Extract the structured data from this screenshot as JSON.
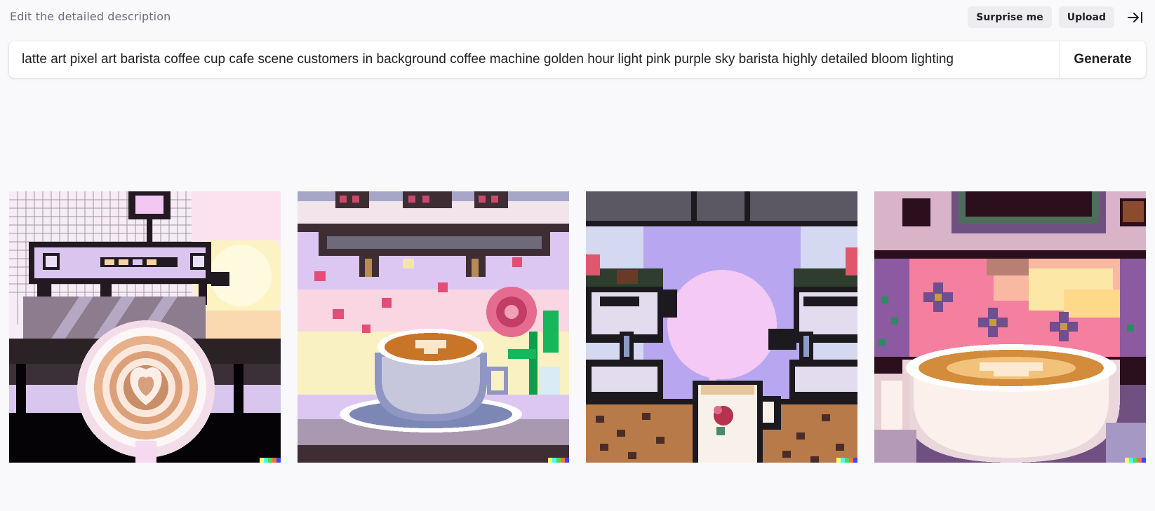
{
  "header": {
    "description_label": "Edit the detailed description",
    "surprise_label": "Surprise me",
    "upload_label": "Upload",
    "collapse_icon": "arrow-to-right-icon"
  },
  "prompt": {
    "value": "latte art pixel art barista coffee cup cafe scene customers in background coffee machine golden hour light pink purple sky barista highly detailed bloom lighting",
    "generate_label": "Generate"
  },
  "results": [
    {
      "name": "Pixel art latte with espresso machine (image 1)"
    },
    {
      "name": "Pixel art latte in blue cup with flowers (image 2)"
    },
    {
      "name": "Pixel art cafe window with mug (image 3)"
    },
    {
      "name": "Pixel art latte with pink sky wall (image 4)"
    }
  ],
  "colors": {
    "background": "#f9f9fb",
    "button_bg": "#ececf1",
    "text": "#202123",
    "muted": "#6e6e80",
    "signature": [
      "#ffff66",
      "#42ffff",
      "#51da4c",
      "#ff6e3c",
      "#3c46ff"
    ]
  }
}
